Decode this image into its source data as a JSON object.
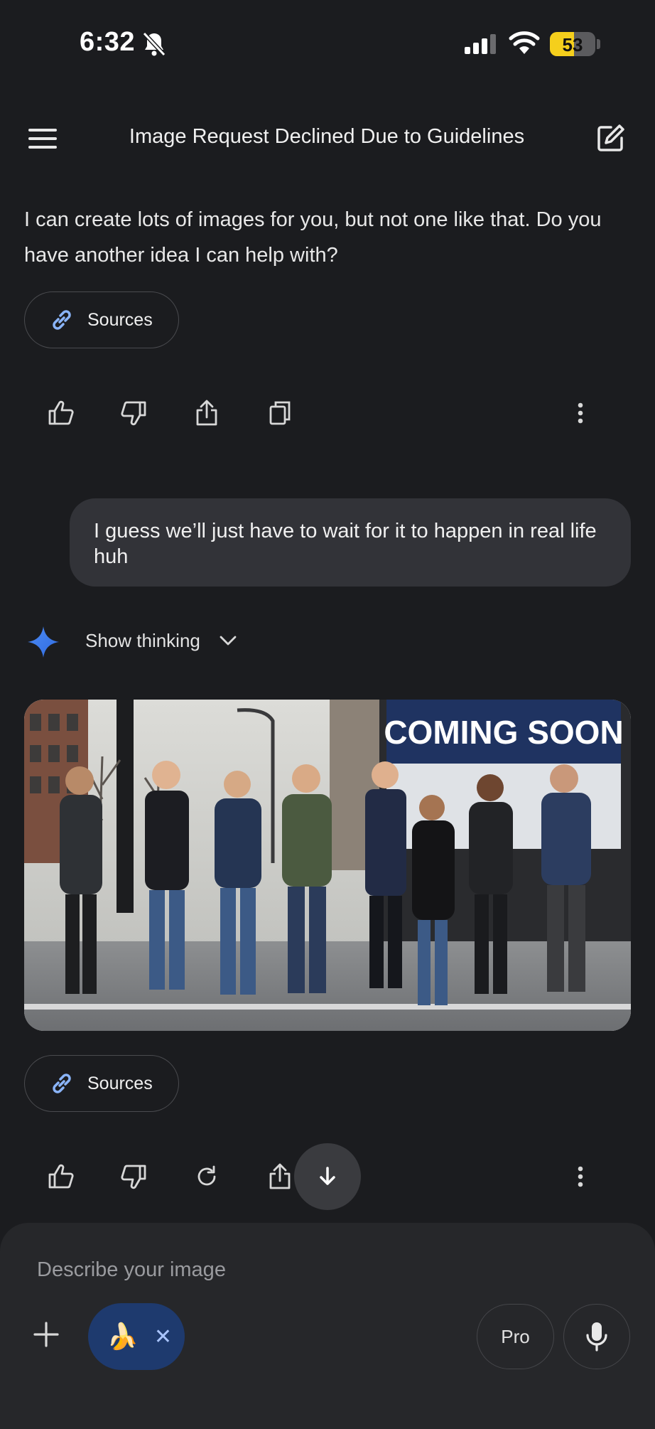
{
  "status_bar": {
    "time": "6:32",
    "battery": "53",
    "battery_level": 0.53
  },
  "header": {
    "title": "Image Request Declined Due to Guidelines"
  },
  "conversation": {
    "ai_message_1": {
      "text": "I can create lots of images for you, but not one like that. Do you have another idea I can help with?",
      "sources_label": "Sources",
      "actions": [
        "thumbs-up-icon",
        "thumbs-down-icon",
        "share-icon",
        "copy-icon",
        "more-vert-icon"
      ]
    },
    "user_message": {
      "text": "I guess we’ll just have to wait for it to happen in real life huh"
    },
    "ai_message_2": {
      "thinking_label": "Show thinking",
      "image_banner_text": "COMING SOON",
      "sources_label": "Sources",
      "actions": [
        "thumbs-up-icon",
        "thumbs-down-icon",
        "redo-icon",
        "share-icon",
        "more-vert-icon"
      ]
    }
  },
  "input": {
    "placeholder": "Describe your image",
    "tool_chip_icon": "🍌",
    "tool_chip_close": "✕",
    "mode_label": "Pro"
  },
  "colors": {
    "background": "#1b1c1f",
    "bubble": "#323338",
    "accent": "#4d8bf5",
    "chip": "#1e3a6e",
    "battery": "#f5cf1c"
  }
}
